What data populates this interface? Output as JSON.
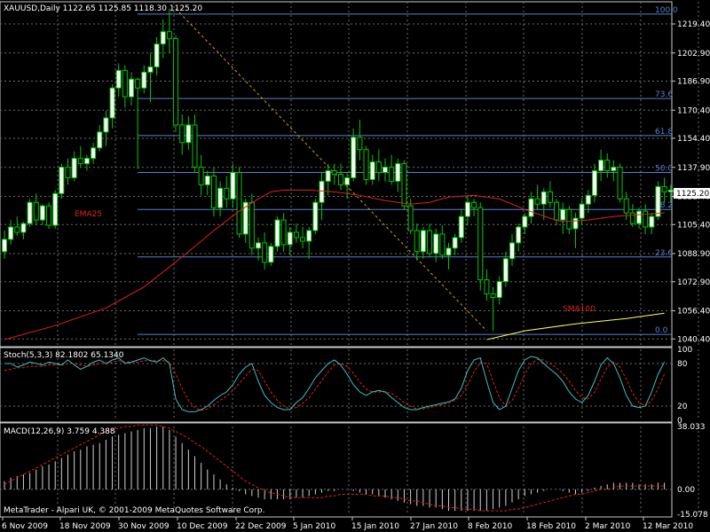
{
  "window": {
    "symbol_header": "XAUUSD,Daily  1122.65 1125.85 1118.30 1125.20",
    "copyright": "MetaTrader - Alpari UK, © 2001-2009 MetaQuotes Software Corp."
  },
  "colors": {
    "background": "#000000",
    "grid": "#6e6e6e",
    "axis": "#c8c8c8",
    "bull_candle": "#ffffff",
    "bear_candle": "#000000",
    "candle_outline": "#00c800",
    "ema": "#e02020",
    "sma": "#ffff60",
    "fib": "#5a7fd0",
    "trendline": "#d0a000",
    "stoch_main": "#40c0c0",
    "stoch_signal": "#e02020",
    "macd_hist": "#d0d0d0",
    "macd_signal": "#e02020"
  },
  "chart_data": [
    {
      "type": "candlestick",
      "title": "XAUUSD,Daily",
      "header_values": {
        "open": 1122.65,
        "high": 1125.85,
        "low": 1118.3,
        "close": 1125.2
      },
      "ylim": [
        1036.0,
        1232.0
      ],
      "y_ticks": [
        1219.4,
        1202.9,
        1186.9,
        1170.4,
        1154.4,
        1137.9,
        1121.4,
        1105.4,
        1088.9,
        1072.9,
        1056.4,
        1040.4
      ],
      "current_price_label": "1125.20",
      "x_ticks": [
        "6 Nov 2009",
        "18 Nov 2009",
        "30 Nov 2009",
        "10 Dec 2009",
        "22 Dec 2009",
        "5 Jan 2010",
        "15 Jan 2010",
        "27 Jan 2010",
        "8 Feb 2010",
        "18 Feb 2010",
        "2 Mar 2010",
        "12 Mar 2010"
      ],
      "candles": [
        [
          1090,
          1102,
          1086,
          1097
        ],
        [
          1097,
          1108,
          1094,
          1104
        ],
        [
          1104,
          1110,
          1099,
          1101
        ],
        [
          1101,
          1107,
          1097,
          1106
        ],
        [
          1106,
          1120,
          1104,
          1118
        ],
        [
          1118,
          1123,
          1105,
          1108
        ],
        [
          1108,
          1117,
          1105,
          1116
        ],
        [
          1116,
          1118,
          1103,
          1105
        ],
        [
          1105,
          1125,
          1103,
          1123
        ],
        [
          1123,
          1140,
          1120,
          1138
        ],
        [
          1138,
          1143,
          1128,
          1132
        ],
        [
          1132,
          1147,
          1130,
          1143
        ],
        [
          1143,
          1150,
          1138,
          1140
        ],
        [
          1140,
          1145,
          1136,
          1143
        ],
        [
          1143,
          1152,
          1140,
          1149
        ],
        [
          1149,
          1162,
          1147,
          1158
        ],
        [
          1158,
          1170,
          1150,
          1166
        ],
        [
          1166,
          1185,
          1160,
          1183
        ],
        [
          1183,
          1197,
          1178,
          1193
        ],
        [
          1193,
          1196,
          1172,
          1178
        ],
        [
          1178,
          1192,
          1173,
          1188
        ],
        [
          1188,
          1189,
          1137,
          1183
        ],
        [
          1183,
          1196,
          1180,
          1192
        ],
        [
          1192,
          1203,
          1175,
          1195
        ],
        [
          1195,
          1212,
          1190,
          1208
        ],
        [
          1208,
          1222,
          1200,
          1215
        ],
        [
          1215,
          1228,
          1203,
          1211
        ],
        [
          1211,
          1213,
          1158,
          1162
        ],
        [
          1162,
          1168,
          1145,
          1152
        ],
        [
          1152,
          1167,
          1148,
          1162
        ],
        [
          1162,
          1168,
          1135,
          1138
        ],
        [
          1138,
          1145,
          1122,
          1128
        ],
        [
          1128,
          1136,
          1122,
          1133
        ],
        [
          1133,
          1138,
          1110,
          1115
        ],
        [
          1115,
          1130,
          1110,
          1126
        ],
        [
          1126,
          1133,
          1115,
          1120
        ],
        [
          1120,
          1140,
          1115,
          1135
        ],
        [
          1135,
          1138,
          1098,
          1100
        ],
        [
          1100,
          1120,
          1095,
          1118
        ],
        [
          1118,
          1123,
          1088,
          1092
        ],
        [
          1092,
          1098,
          1085,
          1095
        ],
        [
          1095,
          1101,
          1080,
          1084
        ],
        [
          1084,
          1095,
          1082,
          1093
        ],
        [
          1093,
          1110,
          1090,
          1108
        ],
        [
          1108,
          1112,
          1090,
          1094
        ],
        [
          1094,
          1104,
          1088,
          1101
        ],
        [
          1101,
          1106,
          1095,
          1098
        ],
        [
          1098,
          1104,
          1092,
          1096
        ],
        [
          1096,
          1104,
          1086,
          1102
        ],
        [
          1102,
          1120,
          1100,
          1118
        ],
        [
          1118,
          1135,
          1108,
          1130
        ],
        [
          1130,
          1140,
          1122,
          1136
        ],
        [
          1136,
          1140,
          1128,
          1134
        ],
        [
          1134,
          1140,
          1125,
          1128
        ],
        [
          1128,
          1135,
          1120,
          1132
        ],
        [
          1132,
          1160,
          1130,
          1155
        ],
        [
          1155,
          1165,
          1142,
          1148
        ],
        [
          1148,
          1150,
          1128,
          1131
        ],
        [
          1131,
          1145,
          1128,
          1141
        ],
        [
          1141,
          1148,
          1130,
          1135
        ],
        [
          1135,
          1143,
          1130,
          1138
        ],
        [
          1138,
          1145,
          1128,
          1130
        ],
        [
          1130,
          1143,
          1124,
          1140
        ],
        [
          1140,
          1142,
          1114,
          1116
        ],
        [
          1116,
          1120,
          1100,
          1102
        ],
        [
          1102,
          1106,
          1085,
          1090
        ],
        [
          1090,
          1104,
          1086,
          1102
        ],
        [
          1102,
          1106,
          1087,
          1089
        ],
        [
          1089,
          1103,
          1084,
          1100
        ],
        [
          1100,
          1105,
          1086,
          1088
        ],
        [
          1088,
          1095,
          1080,
          1092
        ],
        [
          1092,
          1100,
          1088,
          1098
        ],
        [
          1098,
          1114,
          1095,
          1110
        ],
        [
          1110,
          1122,
          1105,
          1118
        ],
        [
          1118,
          1120,
          1110,
          1115
        ],
        [
          1115,
          1118,
          1068,
          1074
        ],
        [
          1074,
          1080,
          1062,
          1066
        ],
        [
          1066,
          1070,
          1045,
          1064
        ],
        [
          1064,
          1076,
          1060,
          1073
        ],
        [
          1073,
          1090,
          1070,
          1086
        ],
        [
          1086,
          1100,
          1082,
          1095
        ],
        [
          1095,
          1106,
          1090,
          1104
        ],
        [
          1104,
          1112,
          1100,
          1110
        ],
        [
          1110,
          1124,
          1106,
          1120
        ],
        [
          1120,
          1128,
          1114,
          1117
        ],
        [
          1117,
          1126,
          1108,
          1124
        ],
        [
          1124,
          1130,
          1115,
          1118
        ],
        [
          1118,
          1120,
          1105,
          1108
        ],
        [
          1108,
          1118,
          1100,
          1114
        ],
        [
          1114,
          1116,
          1100,
          1103
        ],
        [
          1103,
          1112,
          1092,
          1109
        ],
        [
          1109,
          1120,
          1105,
          1117
        ],
        [
          1117,
          1125,
          1112,
          1122
        ],
        [
          1122,
          1140,
          1118,
          1136
        ],
        [
          1136,
          1148,
          1130,
          1142
        ],
        [
          1142,
          1146,
          1132,
          1136
        ],
        [
          1136,
          1142,
          1130,
          1138
        ],
        [
          1138,
          1140,
          1118,
          1120
        ],
        [
          1120,
          1124,
          1108,
          1112
        ],
        [
          1112,
          1117,
          1104,
          1106
        ],
        [
          1106,
          1115,
          1103,
          1113
        ],
        [
          1113,
          1117,
          1100,
          1104
        ],
        [
          1104,
          1112,
          1100,
          1110
        ],
        [
          1110,
          1130,
          1108,
          1127
        ],
        [
          1127,
          1132,
          1118,
          1124
        ],
        [
          1124,
          1128,
          1118,
          1125
        ]
      ],
      "ema_label": "EMA25",
      "ema25": [
        [
          0,
          1040
        ],
        [
          8,
          1048
        ],
        [
          16,
          1058
        ],
        [
          22,
          1070
        ],
        [
          28,
          1087
        ],
        [
          33,
          1102
        ],
        [
          37,
          1113
        ],
        [
          40,
          1120
        ],
        [
          42,
          1124
        ],
        [
          44,
          1125
        ],
        [
          48,
          1125
        ],
        [
          52,
          1124
        ],
        [
          56,
          1122
        ],
        [
          60,
          1119
        ],
        [
          64,
          1117
        ],
        [
          67,
          1118
        ],
        [
          70,
          1121
        ],
        [
          74,
          1122
        ],
        [
          78,
          1120
        ],
        [
          82,
          1114
        ],
        [
          86,
          1109
        ],
        [
          88,
          1107
        ],
        [
          92,
          1108
        ],
        [
          96,
          1110
        ],
        [
          100,
          1111
        ],
        [
          104,
          1112
        ]
      ],
      "sma_label": "SMA100",
      "sma100": [
        [
          76,
          1040
        ],
        [
          82,
          1045
        ],
        [
          90,
          1049
        ],
        [
          98,
          1052
        ],
        [
          104,
          1055
        ]
      ],
      "fib_levels": [
        {
          "label": "100.0",
          "price": 1225.0
        },
        {
          "label": "73.6",
          "price": 1177.0
        },
        {
          "label": "61.8",
          "price": 1156.0
        },
        {
          "label": "50.0",
          "price": 1135.0
        },
        {
          "label": "38.2",
          "price": 1114.0
        },
        {
          "label": "23.6",
          "price": 1087.0
        },
        {
          "label": "0.0",
          "price": 1043.0
        }
      ],
      "trendline": [
        [
          27,
          1228
        ],
        [
          76,
          1045
        ]
      ]
    },
    {
      "type": "line",
      "title": "Stoch(5,3,3) 82.1802 65.1340",
      "ylim": [
        0,
        100
      ],
      "y_ticks": [
        100,
        80,
        20,
        0
      ],
      "main": [
        80,
        80,
        75,
        78,
        82,
        80,
        78,
        82,
        80,
        78,
        85,
        78,
        72,
        76,
        82,
        85,
        80,
        85,
        88,
        80,
        82,
        85,
        88,
        84,
        82,
        88,
        80,
        30,
        15,
        12,
        12,
        15,
        20,
        28,
        35,
        40,
        50,
        65,
        75,
        80,
        55,
        35,
        25,
        18,
        15,
        15,
        25,
        32,
        45,
        60,
        70,
        80,
        85,
        78,
        65,
        50,
        40,
        35,
        40,
        42,
        40,
        32,
        25,
        18,
        15,
        15,
        18,
        20,
        22,
        24,
        26,
        30,
        45,
        70,
        85,
        88,
        55,
        25,
        15,
        20,
        45,
        70,
        85,
        90,
        88,
        80,
        72,
        65,
        55,
        40,
        30,
        25,
        35,
        55,
        78,
        88,
        80,
        60,
        35,
        20,
        18,
        20,
        40,
        65,
        82
      ],
      "signal": [
        70,
        72,
        74,
        74,
        76,
        76,
        76,
        78,
        78,
        78,
        80,
        80,
        78,
        76,
        78,
        80,
        80,
        82,
        84,
        82,
        82,
        82,
        84,
        84,
        84,
        84,
        82,
        65,
        45,
        28,
        18,
        14,
        16,
        22,
        28,
        34,
        42,
        52,
        62,
        72,
        70,
        55,
        40,
        28,
        20,
        16,
        18,
        24,
        32,
        44,
        56,
        68,
        78,
        80,
        76,
        66,
        54,
        44,
        40,
        40,
        40,
        38,
        32,
        25,
        20,
        16,
        16,
        18,
        20,
        22,
        24,
        28,
        35,
        50,
        68,
        82,
        80,
        55,
        32,
        20,
        28,
        45,
        65,
        80,
        86,
        85,
        80,
        74,
        66,
        55,
        42,
        32,
        30,
        40,
        58,
        75,
        82,
        75,
        58,
        38,
        25,
        20,
        28,
        45,
        65
      ]
    },
    {
      "type": "bar",
      "title": "MACD(12,26,9) 3.759 4.388",
      "ylim": [
        -15.078,
        38.033
      ],
      "y_ticks": [
        38.033,
        0.0,
        -15.078
      ],
      "histogram": [
        5,
        7,
        8,
        9,
        10,
        12,
        14,
        15,
        17,
        19,
        21,
        23,
        24,
        26,
        27,
        28,
        30,
        32,
        33,
        34,
        35,
        36,
        37,
        37,
        38,
        38,
        36,
        32,
        28,
        24,
        20,
        16,
        12,
        9,
        6,
        3,
        1,
        -1,
        -3,
        -4,
        -5,
        -6,
        -6,
        -6,
        -6,
        -6,
        -5,
        -5,
        -4,
        -3,
        -2,
        -1,
        -1,
        0,
        0,
        -1,
        -2,
        -3,
        -3,
        -4,
        -5,
        -6,
        -7,
        -8,
        -9,
        -10,
        -10,
        -11,
        -11,
        -12,
        -13,
        -13,
        -13,
        -13,
        -13,
        -13,
        -13,
        -12,
        -11,
        -10,
        -8,
        -6,
        -4,
        -3,
        -2,
        -1,
        0,
        0,
        -1,
        -2,
        -3,
        -2,
        -1,
        1,
        2,
        3,
        4,
        4,
        4,
        4,
        3,
        3,
        3,
        4,
        4
      ],
      "signal": [
        3,
        5,
        7,
        9,
        11,
        13,
        15,
        17,
        19,
        21,
        23,
        25,
        27,
        29,
        31,
        33,
        35,
        36,
        37,
        38,
        38,
        39,
        39,
        39,
        39,
        38,
        37,
        35,
        33,
        31,
        28,
        26,
        23,
        20,
        17,
        14,
        11,
        8,
        5,
        3,
        1,
        -1,
        -2,
        -3,
        -4,
        -5,
        -5,
        -5,
        -5,
        -5,
        -5,
        -4,
        -4,
        -3,
        -3,
        -3,
        -3,
        -3,
        -4,
        -4,
        -4,
        -5,
        -5,
        -6,
        -7,
        -7,
        -8,
        -9,
        -10,
        -10,
        -11,
        -11,
        -12,
        -12,
        -12,
        -13,
        -13,
        -13,
        -13,
        -13,
        -12,
        -12,
        -11,
        -10,
        -9,
        -8,
        -7,
        -6,
        -5,
        -4,
        -3,
        -3,
        -2,
        -1,
        0,
        0,
        1,
        2,
        2,
        2,
        2,
        2,
        2,
        2,
        2
      ]
    }
  ]
}
